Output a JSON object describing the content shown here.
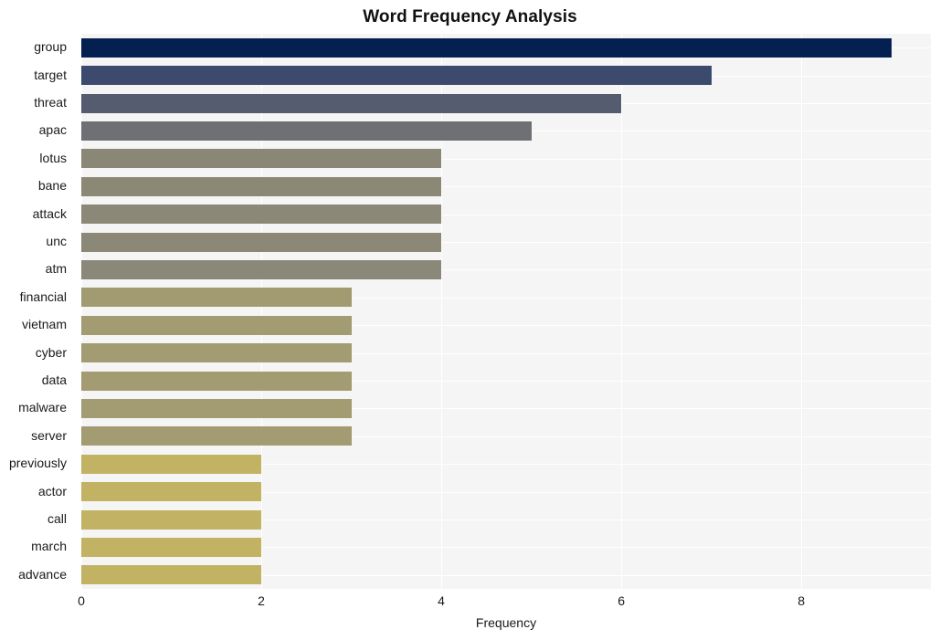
{
  "chart_data": {
    "type": "bar",
    "orientation": "horizontal",
    "title": "Word Frequency Analysis",
    "xlabel": "Frequency",
    "ylabel": "",
    "categories": [
      "group",
      "target",
      "threat",
      "apac",
      "lotus",
      "bane",
      "attack",
      "unc",
      "atm",
      "financial",
      "vietnam",
      "cyber",
      "data",
      "malware",
      "server",
      "previously",
      "actor",
      "call",
      "march",
      "advance"
    ],
    "values": [
      9,
      7,
      6,
      5,
      4,
      4,
      4,
      4,
      4,
      3,
      3,
      3,
      3,
      3,
      3,
      2,
      2,
      2,
      2,
      2
    ],
    "bar_colors": [
      "#042050",
      "#3c4a6e",
      "#565c70",
      "#6f7073",
      "#8b8777",
      "#8c8876",
      "#8b8878",
      "#8b8877",
      "#8a8878",
      "#a29a71",
      "#a39b72",
      "#a39b72",
      "#a39b72",
      "#a39b72",
      "#a39b72",
      "#c2b263",
      "#c2b263",
      "#c2b263",
      "#c2b263",
      "#c2b263"
    ],
    "xticks": [
      0,
      2,
      4,
      6,
      8
    ],
    "xlim": [
      0,
      9.44
    ],
    "grid": true,
    "legend": "none",
    "plot_background": "#f5f5f5",
    "grid_color": "#ffffff",
    "figure_background": "#ffffff"
  }
}
